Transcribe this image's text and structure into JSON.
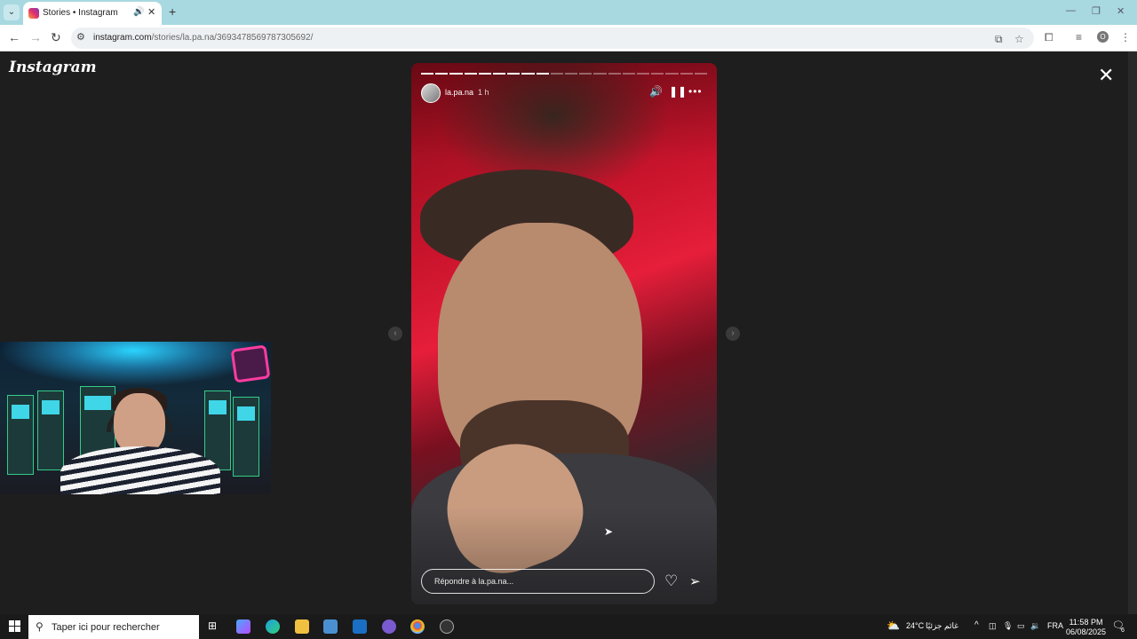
{
  "browser": {
    "tab_title": "Stories • Instagram",
    "url_host": "instagram.com",
    "url_path": "/stories/la.pa.na/3693478569787305692/",
    "profile_initial": "O"
  },
  "page": {
    "logo": "Instagram",
    "close_glyph": "✕"
  },
  "story": {
    "username": "la.pa.na",
    "time_ago": "1 h",
    "progress_total": 20,
    "progress_done": 9,
    "reply_placeholder": "Répondre à la.pa.na..."
  },
  "taskbar": {
    "search_placeholder": "Taper ici pour rechercher",
    "weather": "24°C",
    "weather_text": "غائم جزئيًا",
    "language": "FRA",
    "time": "11:58 PM",
    "date": "06/08/2025",
    "notifications": "6"
  },
  "colors": {
    "tab_strip": "#a8d8e0",
    "page_bg": "#1e1e1e",
    "story_red": "#e61e3a"
  }
}
